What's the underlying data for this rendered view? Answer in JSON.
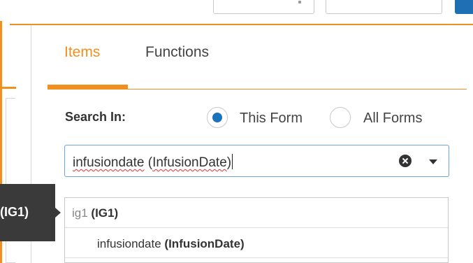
{
  "tabs": [
    {
      "label": "Items",
      "active": true
    },
    {
      "label": "Functions",
      "active": false
    }
  ],
  "search": {
    "label": "Search In:",
    "scope_options": [
      {
        "label": "This Form",
        "selected": true
      },
      {
        "label": "All Forms",
        "selected": false
      }
    ],
    "value_name": "infusiondate",
    "value_oid": "InfusionDate"
  },
  "tooltip": {
    "text": "(IG1)"
  },
  "results": {
    "group": {
      "name": "ig1",
      "oid": "(IG1)"
    },
    "items": [
      {
        "name": "infusiondate",
        "oid": "(InfusionDate)"
      }
    ]
  },
  "colors": {
    "accent": "#f0901e",
    "radio_selected": "#1d72bd",
    "focus_border": "#6ea6d8"
  }
}
